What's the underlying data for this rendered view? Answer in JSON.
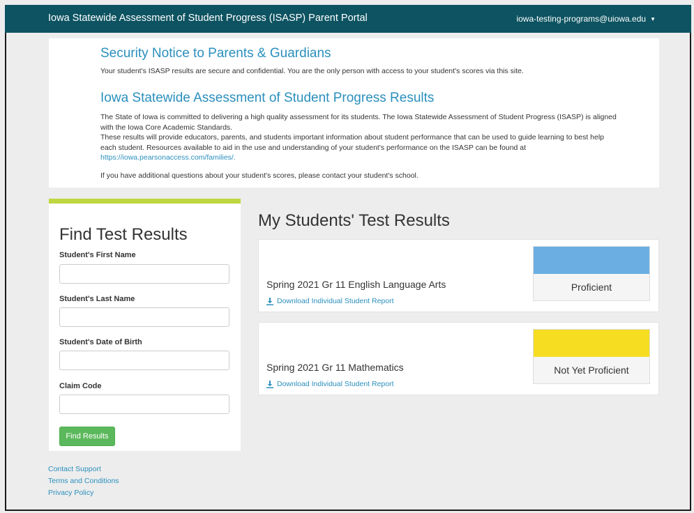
{
  "header": {
    "title": "Iowa Statewide Assessment of Student Progress (ISASP) Parent Portal",
    "user_email": "iowa-testing-programs@uiowa.edu",
    "user_caret_icon": "caret-down-icon",
    "bg_color": "#0d5361"
  },
  "notice": {
    "security_heading": "Security Notice to Parents & Guardians",
    "security_text": "Your student's ISASP results are secure and confidential. You are the only person with access to your student's scores via this site.",
    "results_heading": "Iowa Statewide Assessment of Student Progress Results",
    "para1": "The State of Iowa is committed to delivering a high quality assessment for its students. The Iowa Statewide Assessment of Student Progress (ISASP) is aligned with the Iowa Core Academic Standards.",
    "para2": "These results will provide educators, parents, and students important information about student performance that can be used to guide learning to best help each student. Resources available to aid in the use and understanding of your student's performance on the ISASP can be found at",
    "link": "https://iowa.pearsonaccess.com/families/.",
    "para3": "If you have additional questions about your student's scores, please contact your student's school.",
    "heading_color": "#2a8fbd"
  },
  "find": {
    "title": "Find Test Results",
    "first_name_label": "Student's First Name",
    "first_name_value": "",
    "last_name_label": "Student's Last Name",
    "last_name_value": "",
    "dob_label": "Student's Date of Birth",
    "dob_value": "",
    "claim_label": "Claim Code",
    "claim_value": "",
    "button_label": "Find Results",
    "accent_color": "#bfd640",
    "button_color": "#5cb85c"
  },
  "footer": {
    "links": [
      "Contact Support",
      "Terms and Conditions",
      "Privacy Policy"
    ]
  },
  "results": {
    "title": "My Students' Test Results",
    "items": [
      {
        "name": "Spring 2021 Gr 11 English Language Arts",
        "download_label": "Download Individual Student Report",
        "download_icon": "download-icon",
        "level": "Proficient",
        "level_color": "#6aaee2"
      },
      {
        "name": "Spring 2021 Gr 11 Mathematics",
        "download_label": "Download Individual Student Report",
        "download_icon": "download-icon",
        "level": "Not Yet Proficient",
        "level_color": "#f6dd22"
      }
    ]
  }
}
